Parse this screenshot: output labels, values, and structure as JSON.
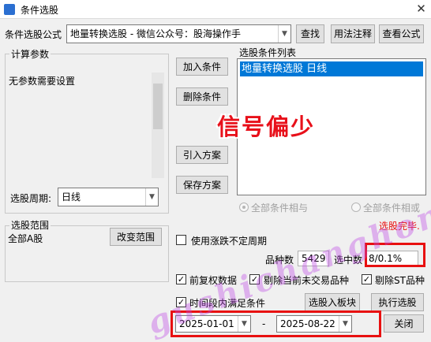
{
  "window": {
    "title": "条件选股",
    "close_glyph": "✕"
  },
  "formula": {
    "label": "条件选股公式",
    "value": "地量转换选股  -  微信公众号：股海操作手",
    "btn_find": "查找",
    "btn_usage": "用法注释",
    "btn_view": "查看公式"
  },
  "params": {
    "group_title": "计算参数",
    "text": "无参数需要设置",
    "period_label": "选股周期:",
    "period_value": "日线"
  },
  "actions": {
    "add": "加入条件",
    "remove": "删除条件",
    "import": "引入方案",
    "save": "保存方案"
  },
  "conditions": {
    "title": "选股条件列表",
    "items": [
      "地量转换选股  日线"
    ],
    "radio_and": "全部条件相与",
    "radio_or": "全部条件相或"
  },
  "overlay": {
    "text": "信号偏少"
  },
  "watermark": {
    "text": "gushichanghong.com"
  },
  "scope": {
    "group_title": "选股范围",
    "value": "全部A股",
    "btn_change": "改变范围"
  },
  "status": {
    "done_text": "选股完毕.",
    "variable_period": "使用涨跌不定周期",
    "count_label": "品种数",
    "count_value": "5429",
    "selected_label": "选中数",
    "selected_value": "8/0.1%"
  },
  "options": {
    "pre_adjust": "前复权数据",
    "exclude_untraded": "剔除当前未交易品种",
    "exclude_st": "剔除ST品种",
    "time_range": "时间段内满足条件",
    "date_from": "2025-01-01",
    "date_sep": "-",
    "date_to": "2025-08-22",
    "btn_to_block": "选股入板块",
    "btn_execute": "执行选股",
    "btn_close": "关闭"
  },
  "colors": {
    "accent": "#0078d7",
    "done_red": "#e81010",
    "overlay_red": "#e8101a",
    "watermark_violet": "#be46e6"
  }
}
